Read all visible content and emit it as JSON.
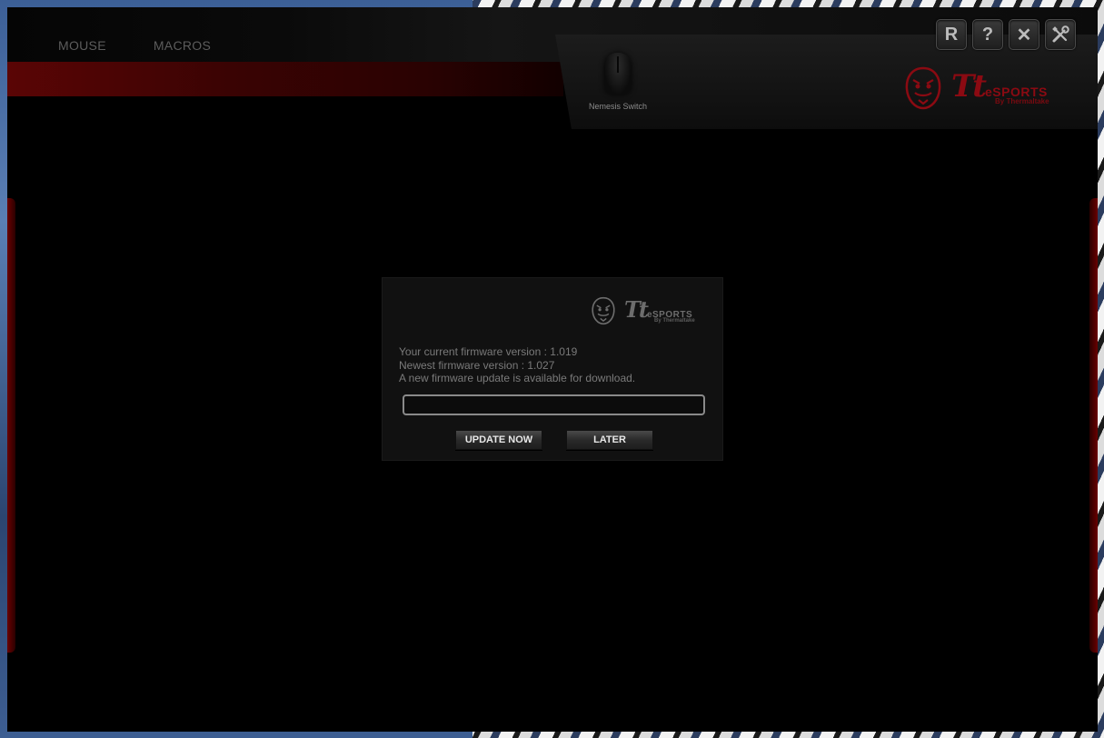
{
  "nav": {
    "tabs": [
      {
        "label": "MOUSE"
      },
      {
        "label": "MACROS"
      }
    ]
  },
  "device": {
    "label": "Nemesis Switch"
  },
  "window_controls": {
    "reset_glyph": "R",
    "help_glyph": "?",
    "close_glyph": "✕",
    "settings_icon": "wrench-screwdriver-icon"
  },
  "brand": {
    "tt": "Tt",
    "esports": "eSPORTS",
    "sub": "By Thermaltake",
    "color": "#8b0a12"
  },
  "dialog": {
    "brand": {
      "tt": "Tt",
      "esports": "eSPORTS",
      "sub": "By Thermaltake"
    },
    "current_version_line": "Your current firmware version : 1.019",
    "newest_version_line": "Newest firmware version : 1.027",
    "availability_line": "A new firmware update is available for download.",
    "progress": 0,
    "update_now_label": "UPDATE NOW",
    "later_label": "LATER"
  }
}
